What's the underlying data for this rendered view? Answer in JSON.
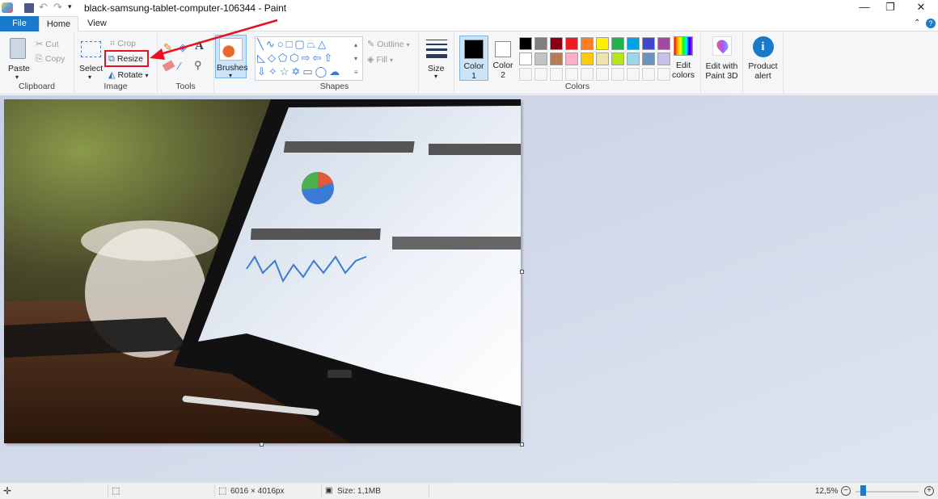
{
  "window": {
    "title": "black-samsung-tablet-computer-106344 - Paint",
    "minimize": "—",
    "restore": "❐",
    "close": "✕"
  },
  "tabs": [
    {
      "label": "File"
    },
    {
      "label": "Home"
    },
    {
      "label": "View"
    }
  ],
  "ribbon": {
    "clipboard": {
      "label": "Clipboard",
      "paste": "Paste",
      "cut": "Cut",
      "copy": "Copy"
    },
    "image": {
      "label": "Image",
      "select": "Select",
      "crop": "Crop",
      "resize": "Resize",
      "rotate": "Rotate"
    },
    "tools": {
      "label": "Tools"
    },
    "brushes": {
      "label": "Brushes"
    },
    "shapes": {
      "label": "Shapes",
      "outline": "Outline",
      "fill": "Fill"
    },
    "size": {
      "label": "Size"
    },
    "colors": {
      "label": "Colors",
      "color1": "Color",
      "color1_num": "1",
      "color2": "Color",
      "color2_num": "2",
      "edit": "Edit",
      "edit2": "colors",
      "palette_row1": [
        "#000000",
        "#7f7f7f",
        "#880015",
        "#ed1c24",
        "#ff7f27",
        "#fff200",
        "#22b14c",
        "#00a2e8",
        "#3f48cc",
        "#a349a4"
      ],
      "palette_row2": [
        "#ffffff",
        "#c3c3c3",
        "#b97a57",
        "#ffaec9",
        "#ffc90e",
        "#efe4b0",
        "#b5e61d",
        "#99d9ea",
        "#7092be",
        "#c8bfe7"
      ],
      "color1_value": "#000000",
      "color2_value": "#ffffff"
    },
    "paint3d": {
      "line1": "Edit with",
      "line2": "Paint 3D"
    },
    "alert": {
      "line1": "Product",
      "line2": "alert"
    }
  },
  "status": {
    "dimensions": "6016 × 4016px",
    "size": "Size: 1,1MB",
    "zoom": "12,5%",
    "zoom_percent": 12.5
  },
  "annotation": {
    "highlight_color": "#e81123",
    "arrow_color": "#e81123"
  }
}
